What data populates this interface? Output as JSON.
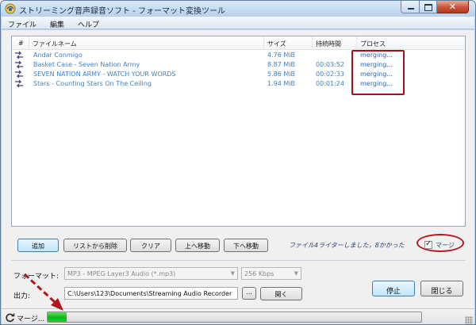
{
  "window": {
    "title": "ストリーミング音声録音ソフト - フォーマット変換ツール"
  },
  "menu": {
    "items": [
      "ファイル",
      "編集",
      "ヘルプ"
    ]
  },
  "list": {
    "columns": {
      "num": "#",
      "name": "ファイルネーム",
      "size": "サイズ",
      "duration": "持続時間",
      "process": "プロセス"
    },
    "rows": [
      {
        "name": "Andar Conmigo",
        "size": "4.76 MiB",
        "duration": "",
        "process": "merging..."
      },
      {
        "name": "Basket Case - Seven Nation Army",
        "size": "8.87 MiB",
        "duration": "00:03:52",
        "process": "merging..."
      },
      {
        "name": "SEVEN NATION ARMY - WATCH YOUR WORDS",
        "size": "5.86 MiB",
        "duration": "00:02:33",
        "process": "merging..."
      },
      {
        "name": "Stars - Counting Stars On The Ceiling",
        "size": "1.94 MiB",
        "duration": "00:01:24",
        "process": "merging..."
      }
    ]
  },
  "buttons": {
    "add": "追加",
    "remove": "リストから削除",
    "clear": "クリア",
    "move_up": "上へ移動",
    "move_down": "下へ移動",
    "stop": "停止",
    "close": "閉じる",
    "browse": "...",
    "open": "開く"
  },
  "merge": {
    "message": "ファイル4ライターしました，8かかった",
    "checkbox_label": "マージ",
    "checked": true
  },
  "format": {
    "label": "フォーマット:",
    "value": "MP3 - MPEG Layer3 Audio (*.mp3)",
    "bitrate": "256 Kbps"
  },
  "output": {
    "label": "出力:",
    "path": "C:\\Users\\123\\Documents\\Streaming Audio Recorder"
  },
  "status": {
    "text": "マージ...",
    "progress_fraction": 0.05
  },
  "colors": {
    "link_blue": "#3e82c8",
    "highlight_red": "#a50f17",
    "progress_green": "#12b21c"
  },
  "icons": {
    "app": "app-record-icon",
    "row": "audio-file-arrows-icon",
    "status": "refresh-icon",
    "close": "close-icon",
    "minimize": "minimize-icon",
    "maximize": "maximize-icon"
  }
}
